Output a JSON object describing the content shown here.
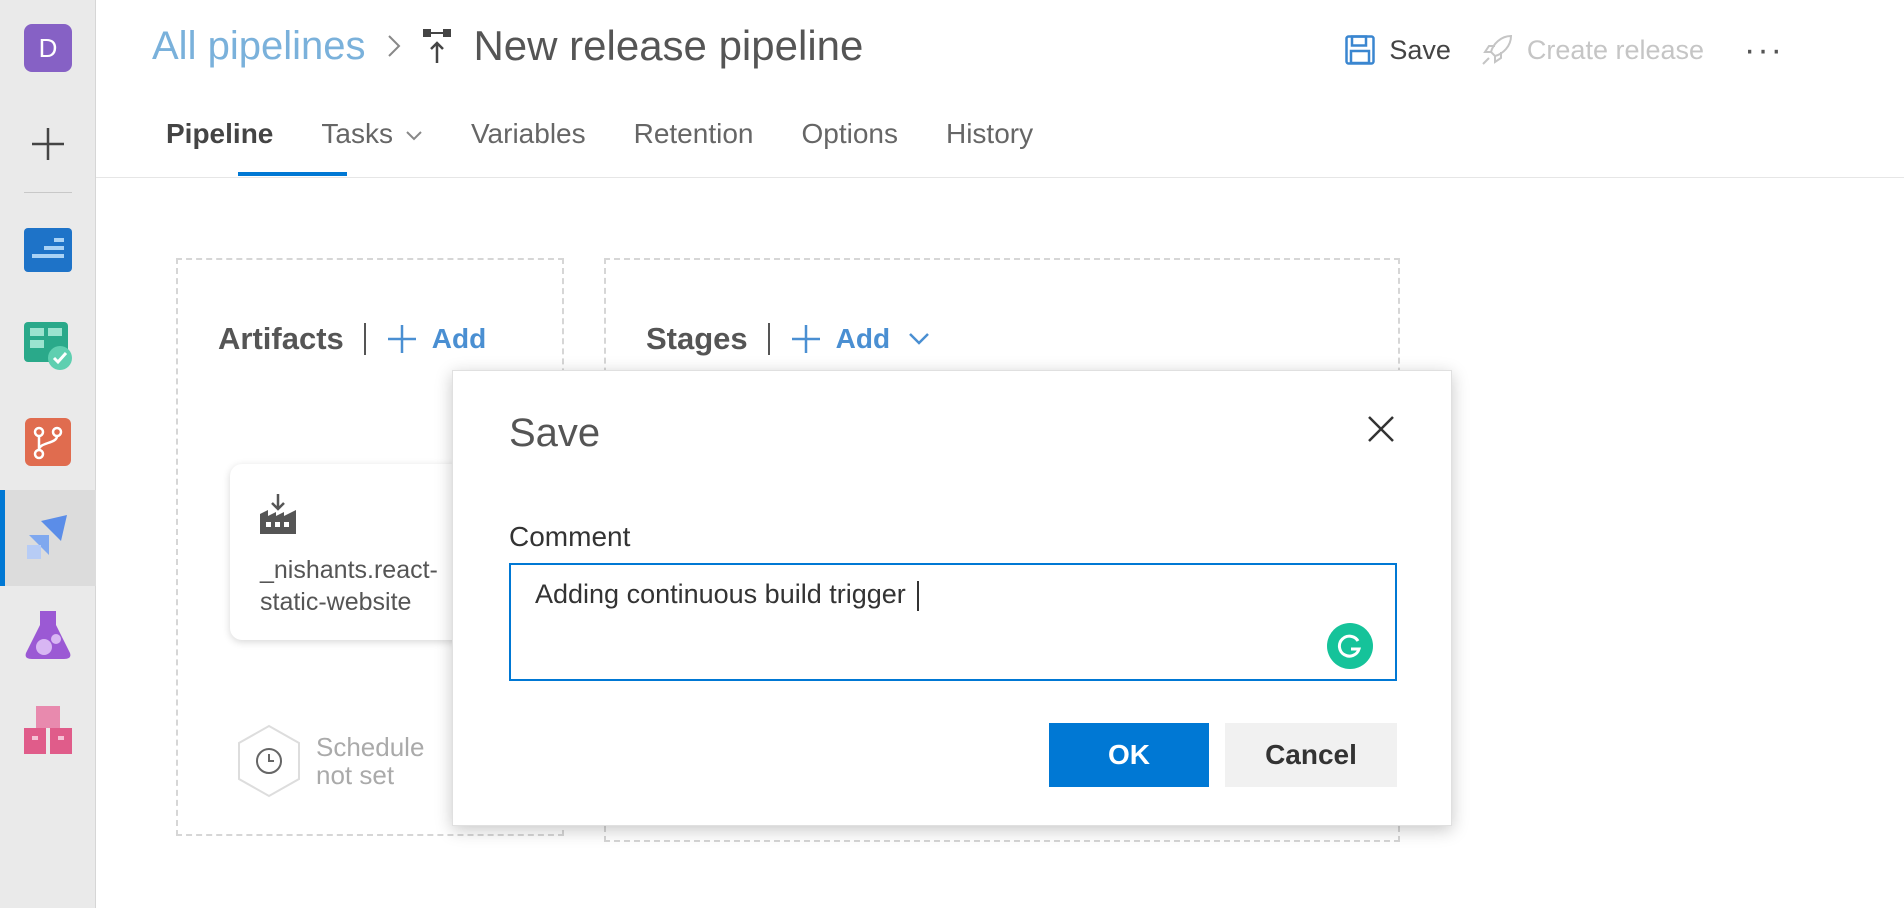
{
  "user": {
    "avatar_initial": "D"
  },
  "breadcrumb": {
    "root": "All pipelines",
    "title": "New release pipeline"
  },
  "toolbar": {
    "save_label": "Save",
    "create_release_label": "Create release",
    "more_label": "···"
  },
  "tabs": [
    {
      "label": "Pipeline",
      "active": true
    },
    {
      "label": "Tasks",
      "has_dropdown": true
    },
    {
      "label": "Variables"
    },
    {
      "label": "Retention"
    },
    {
      "label": "Options"
    },
    {
      "label": "History"
    }
  ],
  "artifacts": {
    "title": "Artifacts",
    "add_label": "Add",
    "card_name": "_nishants.react-static-website",
    "schedule_text": "Schedule not set"
  },
  "stages": {
    "title": "Stages",
    "add_label": "Add"
  },
  "dialog": {
    "title": "Save",
    "comment_label": "Comment",
    "comment_value": "Adding continuous build trigger ",
    "ok_label": "OK",
    "cancel_label": "Cancel"
  },
  "colors": {
    "accent": "#0078d4",
    "link": "#7ab1db",
    "avatar": "#8661c5",
    "grammarly": "#15c39a"
  },
  "icons": {
    "rail": [
      "avatar",
      "plus-icon",
      "boards-icon",
      "test-plans-icon",
      "repos-icon",
      "pipelines-icon",
      "lab-icon",
      "artifacts-icon"
    ]
  }
}
